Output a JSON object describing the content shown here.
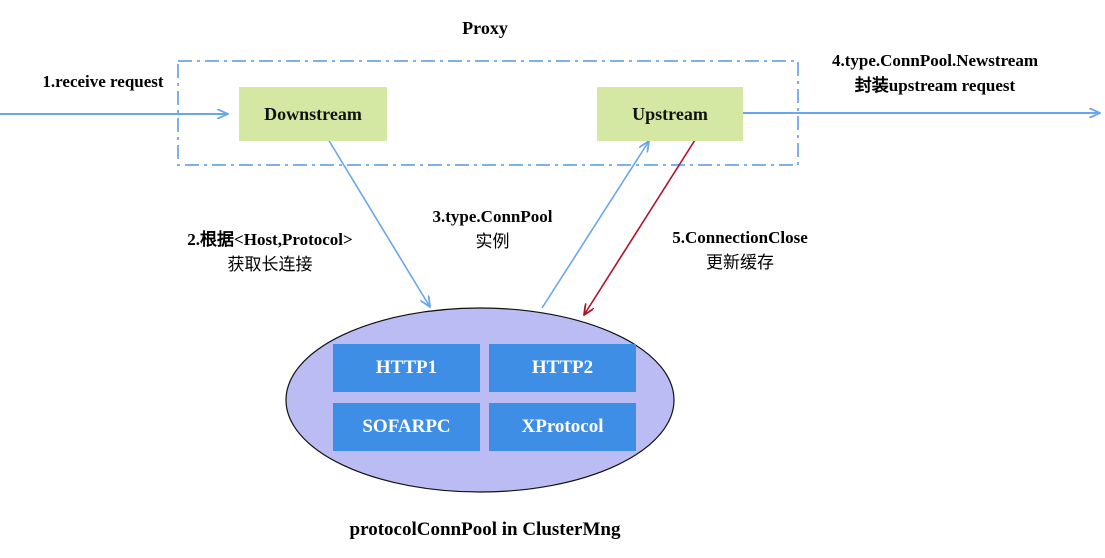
{
  "title": "Proxy",
  "footer": "protocolConnPool in ClusterMng",
  "nodes": {
    "downstream": "Downstream",
    "upstream": "Upstream"
  },
  "protocols": [
    "HTTP1",
    "HTTP2",
    "SOFARPC",
    "XProtocol"
  ],
  "steps": {
    "s1": {
      "line1": "1.receive request"
    },
    "s2": {
      "line1": "2.根据<Host,Protocol>",
      "line2": "获取长连接"
    },
    "s3": {
      "line1": "3.type.ConnPool",
      "line2": "实例"
    },
    "s4": {
      "line1": "4.type.ConnPool.Newstream",
      "line2": "封装upstream request"
    },
    "s5": {
      "line1": "5.ConnectionClose",
      "line2": "更新缓存"
    }
  },
  "colors": {
    "arrow_blue": "#6aa6ec",
    "arrow_red": "#b0122a",
    "node_green": "#d5e8a3",
    "ellipse_fill": "#bcbcf5",
    "protocol_blue": "#3f8ee6",
    "dashed_border": "#7fb0ee"
  }
}
